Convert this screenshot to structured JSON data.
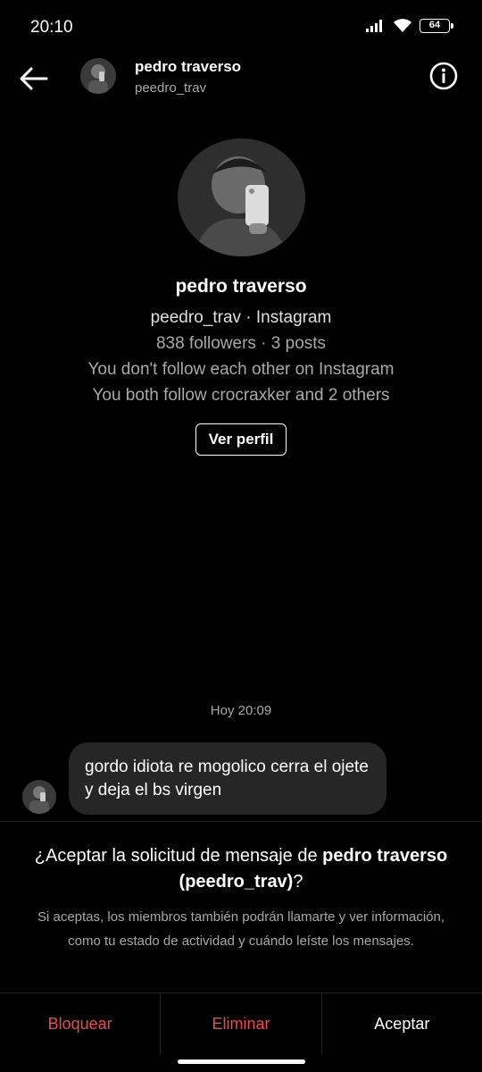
{
  "status_bar": {
    "time": "20:10",
    "battery": "64",
    "icons": [
      "signal-icon",
      "wifi-icon",
      "battery-icon"
    ]
  },
  "header": {
    "name": "pedro traverso",
    "username": "peedro_trav",
    "icons": [
      "back-arrow-icon",
      "info-icon"
    ]
  },
  "profile": {
    "name": "pedro traverso",
    "handle_line": "peedro_trav · Instagram",
    "stats_line": "838 followers · 3 posts",
    "follow_line": "You don't follow each other on Instagram",
    "mutual_line": "You both follow crocraxker and 2 others",
    "view_profile_label": "Ver perfil"
  },
  "thread": {
    "timestamp": "Hoy 20:09",
    "messages": [
      {
        "text": "gordo idiota re mogolico cerra el ojete y deja el bs virgen"
      }
    ]
  },
  "request": {
    "title_prefix": "¿Aceptar la solicitud de mensaje de ",
    "title_name": "pedro traverso",
    "title_user": "(peedro_trav)",
    "title_suffix": "?",
    "description": "Si aceptas, los miembros también podrán llamarte y ver información, como tu estado de actividad y cuándo leíste los mensajes."
  },
  "actions": {
    "block": "Bloquear",
    "delete": "Eliminar",
    "accept": "Aceptar"
  },
  "colors": {
    "background": "#000000",
    "bubble": "#262626",
    "danger": "#ed4956",
    "secondary_text": "#a8a8a8"
  }
}
